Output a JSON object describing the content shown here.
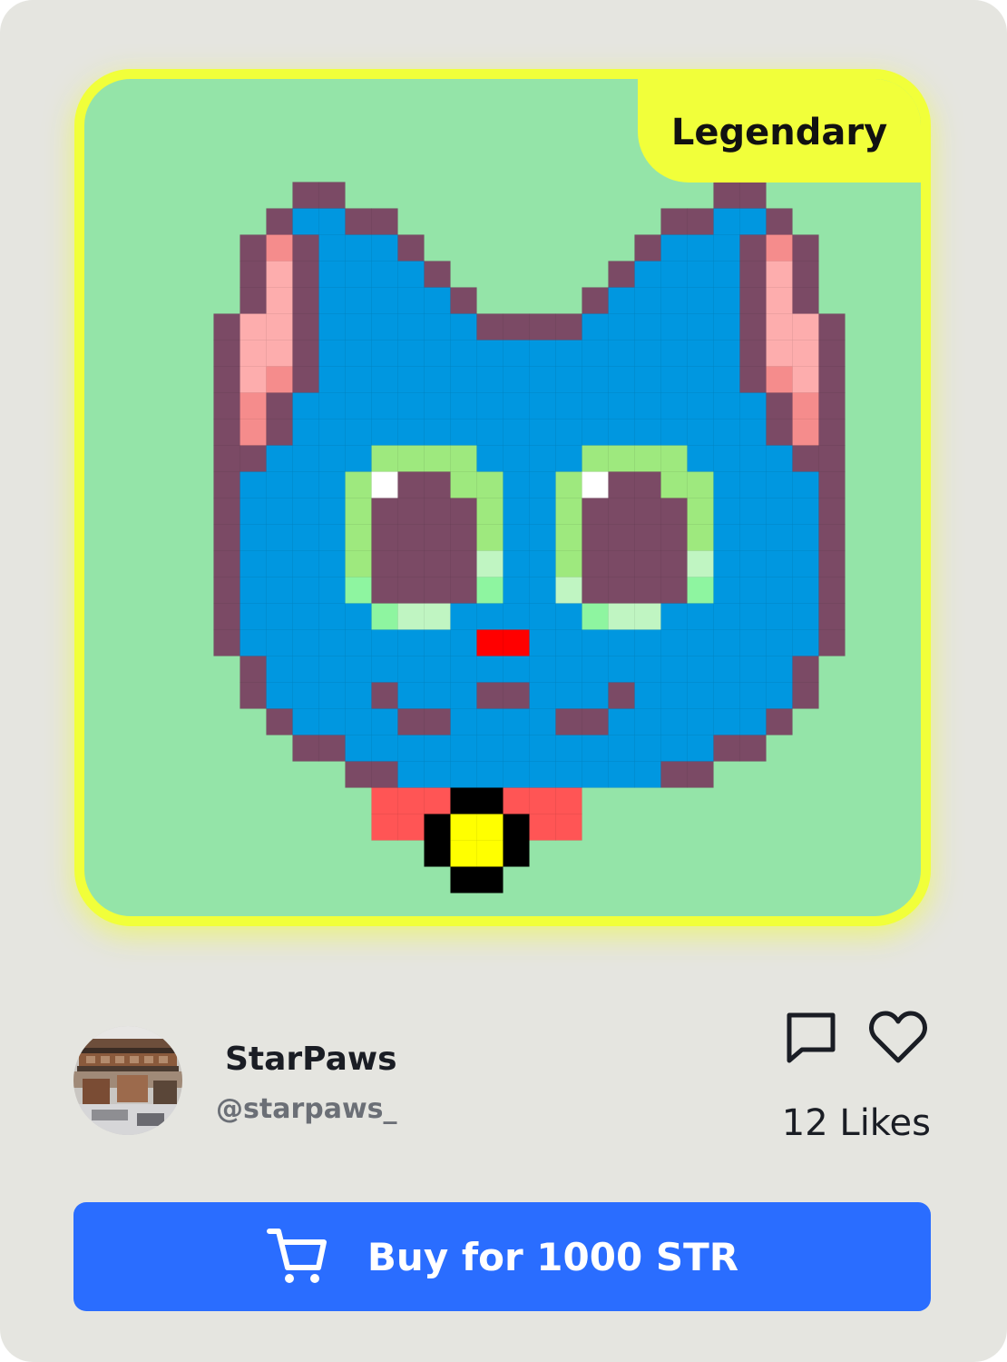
{
  "card": {
    "rarity": "Legendary",
    "artwork_icon": "pixel-cat-icon",
    "colors": {
      "frame": "#f1ff3a",
      "art_background": "#94e4a8",
      "card_background": "#e5e5e0",
      "button": "#2a6dff"
    }
  },
  "creator": {
    "name": "StarPaws",
    "handle": "@starpaws_",
    "avatar_icon": "avatar-photo"
  },
  "actions": {
    "comment_icon": "comment-icon",
    "like_icon": "heart-icon",
    "likes_label": "12 Likes"
  },
  "purchase": {
    "icon": "cart-icon",
    "label": "Buy for 1000 STR"
  }
}
